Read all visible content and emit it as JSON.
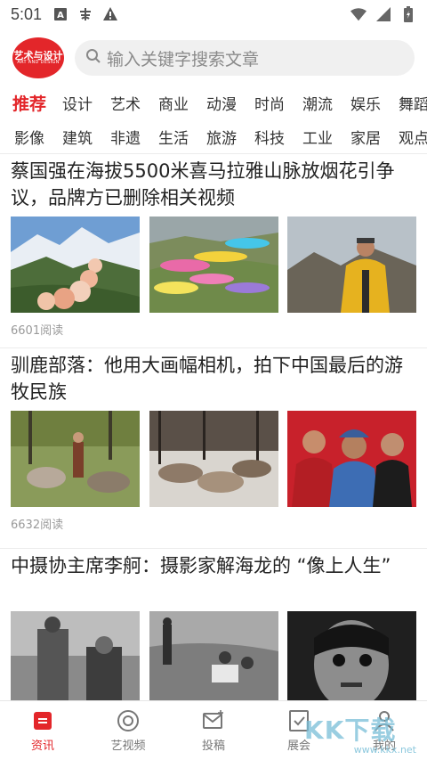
{
  "status_bar": {
    "time": "5:01",
    "icons_left": [
      "a-box-icon",
      "vpn-key-icon",
      "warning-icon"
    ],
    "icons_right": [
      "wifi-icon",
      "cell-signal-icon",
      "battery-icon"
    ]
  },
  "header": {
    "logo_text": "艺术与设计",
    "logo_subtext": "ART AND DESIGN",
    "search_placeholder": "输入关键字搜索文章"
  },
  "categories": {
    "row1": [
      "推荐",
      "设计",
      "艺术",
      "商业",
      "动漫",
      "时尚",
      "潮流",
      "娱乐",
      "舞蹈"
    ],
    "row2": [
      "影像",
      "建筑",
      "非遗",
      "生活",
      "旅游",
      "科技",
      "工业",
      "家居",
      "观点"
    ],
    "active": "推荐"
  },
  "articles": [
    {
      "title": "蔡国强在海拔5500米喜马拉雅山脉放烟花引争议，品牌方已删除相关视频",
      "read_count": "6601阅读"
    },
    {
      "title": "驯鹿部落：他用大画幅相机，拍下中国最后的游牧民族",
      "read_count": "6632阅读"
    },
    {
      "title": "中摄协主席李舸：摄影家解海龙的 “像上人生”",
      "read_count": ""
    }
  ],
  "bottom_nav": [
    {
      "label": "资讯",
      "icon": "news-icon",
      "active": true
    },
    {
      "label": "艺视频",
      "icon": "video-icon",
      "active": false
    },
    {
      "label": "投稿",
      "icon": "submit-icon",
      "active": false
    },
    {
      "label": "展会",
      "icon": "exhibition-icon",
      "active": false
    },
    {
      "label": "我的",
      "icon": "profile-icon",
      "active": false
    }
  ],
  "watermark": {
    "text": "KK下载",
    "url": "www.kkx.net"
  },
  "colors": {
    "accent": "#e3262a",
    "text": "#222222",
    "muted": "#9a9a9a",
    "search_bg": "#f0f0f0"
  }
}
